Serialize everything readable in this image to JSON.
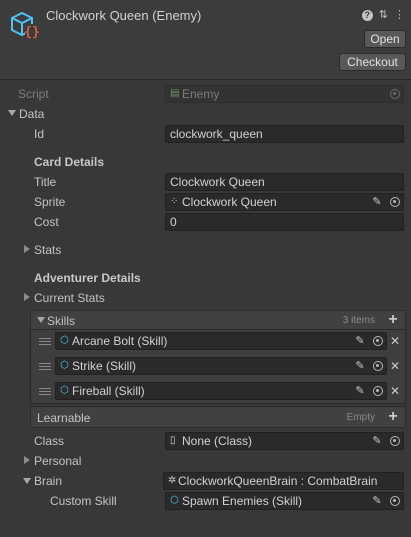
{
  "header": {
    "title": "Clockwork Queen (Enemy)",
    "open_label": "Open",
    "checkout_label": "Checkout"
  },
  "script": {
    "label": "Script",
    "value": "Enemy"
  },
  "data": {
    "label": "Data",
    "id_label": "Id",
    "id_value": "clockwork_queen",
    "card_details": "Card Details",
    "title_label": "Title",
    "title_value": "Clockwork Queen",
    "sprite_label": "Sprite",
    "sprite_value": "Clockwork Queen",
    "cost_label": "Cost",
    "cost_value": "0",
    "stats_label": "Stats",
    "adventurer_details": "Adventurer Details",
    "current_stats_label": "Current Stats",
    "skills": {
      "label": "Skills",
      "count": "3 items",
      "items": [
        "Arcane Bolt (Skill)",
        "Strike (Skill)",
        "Fireball (Skill)"
      ]
    },
    "learnable": {
      "label": "Learnable",
      "status": "Empty"
    },
    "class_label": "Class",
    "class_value": "None (Class)",
    "personal_label": "Personal",
    "brain_label": "Brain",
    "brain_value": "ClockworkQueenBrain : CombatBrain",
    "custom_skill_label": "Custom Skill",
    "custom_skill_value": "Spawn Enemies (Skill)"
  },
  "colors": {
    "background": "#383838",
    "field": "#2a2a2a",
    "text": "#c8c8c8",
    "icon_cyan": "#4fc3f7",
    "icon_red": "#e05a47"
  }
}
